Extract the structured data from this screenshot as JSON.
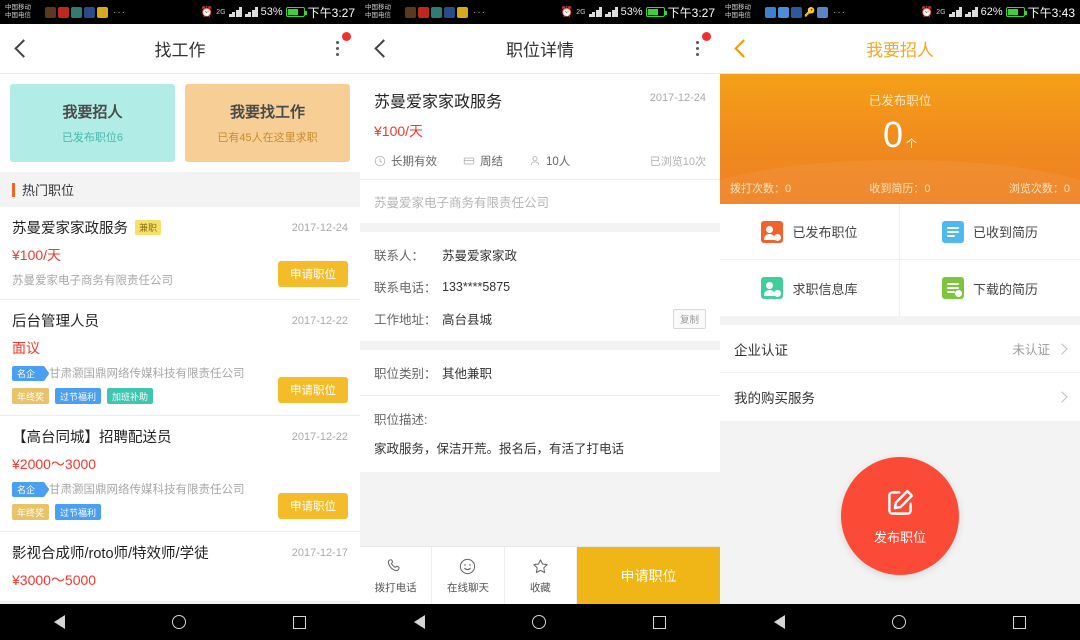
{
  "statusbars": [
    {
      "carrier1": "中国移动",
      "carrier2": "中国电信",
      "battery": "53%",
      "time": "下午3:27",
      "net": "2G"
    },
    {
      "carrier1": "中国移动",
      "carrier2": "中国电信",
      "battery": "53%",
      "time": "下午3:27",
      "net": "2G"
    },
    {
      "carrier1": "中国移动",
      "carrier2": "中国电信",
      "battery": "62%",
      "time": "下午3:43",
      "net": "2G"
    }
  ],
  "panel1": {
    "nav": {
      "title": "找工作",
      "back_icon": "chevron-left-icon",
      "more_icon": "more-vertical-icon"
    },
    "promos": [
      {
        "title": "我要招人",
        "sub": "已发布职位6",
        "color": "#b2ece6"
      },
      {
        "title": "我要找工作",
        "sub": "已有45人在这里求职",
        "color": "#f7cf96"
      }
    ],
    "section_title": "热门职位",
    "apply_label": "申请职位",
    "jobs": [
      {
        "title": "苏曼爱家家政服务",
        "tag": "兼职",
        "date": "2017-12-24",
        "salary": "¥100/天",
        "company": "苏曼爱家电子商务有限责任公司",
        "famous": false,
        "chips": []
      },
      {
        "title": "后台管理人员",
        "tag": "",
        "date": "2017-12-22",
        "salary": "面议",
        "company": "甘肃灏国鼎网络传媒科技有限责任公司",
        "famous": true,
        "famous_label": "名企",
        "chips": [
          "年终奖",
          "过节福利",
          "加班补助"
        ]
      },
      {
        "title": "【高台同城】招聘配送员",
        "tag": "",
        "date": "2017-12-22",
        "salary": "¥2000～3000",
        "company": "甘肃灏国鼎网络传媒科技有限责任公司",
        "famous": true,
        "famous_label": "名企",
        "chips": [
          "年终奖",
          "过节福利"
        ]
      },
      {
        "title": "影视合成师/roto师/特效师/学徒",
        "tag": "",
        "date": "2017-12-17",
        "salary": "¥3000～5000",
        "company": "",
        "famous": false,
        "chips": []
      }
    ]
  },
  "panel2": {
    "nav": {
      "title": "职位详情",
      "back_icon": "chevron-left-icon",
      "more_icon": "more-vertical-icon"
    },
    "job": {
      "title": "苏曼爱家家政服务",
      "date": "2017-12-24",
      "salary": "¥100/天",
      "validity": "长期有效",
      "pay_cycle": "周结",
      "headcount": "10人",
      "views": "已浏览10次",
      "company": "苏曼爱家电子商务有限责任公司"
    },
    "contact": {
      "name_label": "联系人：",
      "name_value": "苏曼爱家家政",
      "phone_label": "联系电话：",
      "phone_value": "133****5875",
      "address_label": "工作地址：",
      "address_value": "高台县城",
      "copy_label": "复制"
    },
    "category": {
      "label": "职位类别：",
      "value": "其他兼职"
    },
    "description": {
      "label": "职位描述:",
      "value": "家政服务，保洁开荒。报名后，有活了打电话"
    },
    "actions": [
      {
        "label": "拨打电话",
        "icon": "phone-icon"
      },
      {
        "label": "在线聊天",
        "icon": "smiley-chat-icon"
      },
      {
        "label": "收藏",
        "icon": "star-icon"
      }
    ],
    "apply_label": "申请职位"
  },
  "panel3": {
    "nav": {
      "title": "我要招人",
      "back_icon": "chevron-left-icon"
    },
    "card": {
      "label": "已发布职位",
      "count": "0",
      "unit": "个",
      "stats": [
        "拨打次数：0",
        "收到简历：0",
        "浏览次数：0"
      ],
      "bg_color": "#f2901e"
    },
    "grid": [
      {
        "label": "已发布职位",
        "icon": "published-jobs-icon",
        "color": "#f2622c"
      },
      {
        "label": "已收到简历",
        "icon": "received-resumes-icon",
        "color": "#4fb9ef"
      },
      {
        "label": "求职信息库",
        "icon": "jobseeker-database-icon",
        "color": "#3ecf9a"
      },
      {
        "label": "下载的简历",
        "icon": "downloaded-resumes-icon",
        "color": "#7cc63f"
      }
    ],
    "list": [
      {
        "label": "企业认证",
        "value": "未认证"
      },
      {
        "label": "我的购买服务",
        "value": ""
      }
    ],
    "fab": {
      "label": "发布职位",
      "icon": "edit-square-icon",
      "color": "#fb4b36"
    }
  }
}
